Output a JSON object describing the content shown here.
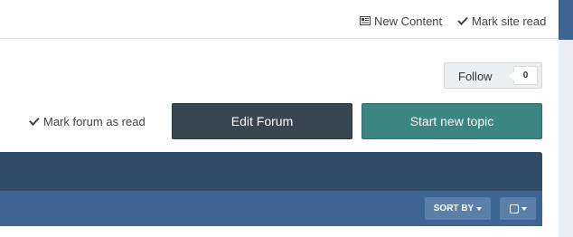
{
  "top_bar": {
    "new_content_label": "New Content",
    "new_content_icon": "newspaper-icon",
    "mark_site_read_label": "Mark site read",
    "mark_site_read_icon": "check-icon"
  },
  "follow": {
    "label": "Follow",
    "count": "0"
  },
  "actions": {
    "mark_forum_read_label": "Mark forum as read",
    "edit_forum_label": "Edit Forum",
    "start_new_topic_label": "Start new topic"
  },
  "toolbar": {
    "sort_by_label": "SORT BY"
  },
  "colors": {
    "edit_button": "#37474f",
    "start_button": "#3b8582",
    "forum_header": "#2f4b66",
    "forum_toolbar": "#3d6594"
  }
}
